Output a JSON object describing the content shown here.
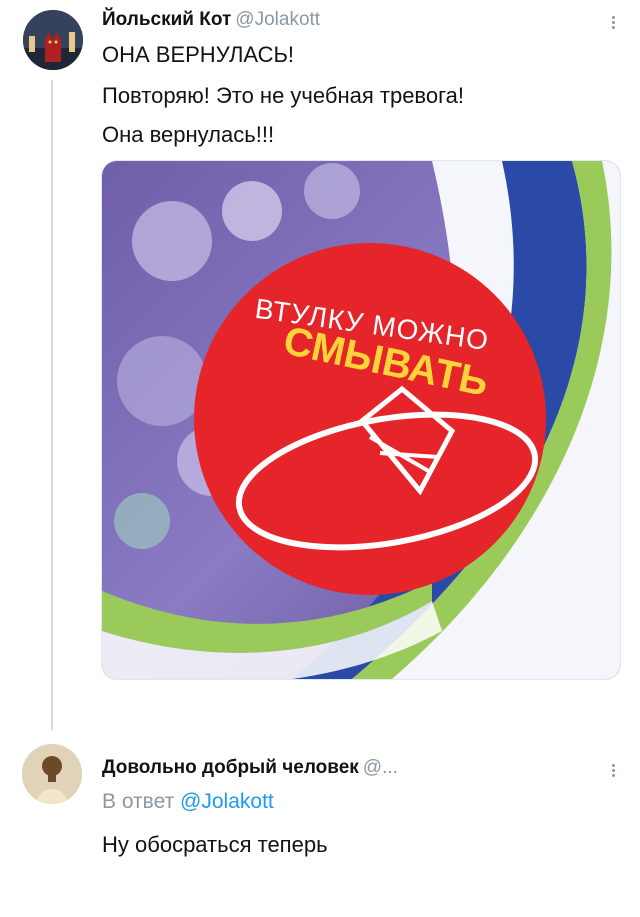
{
  "tweet": {
    "author_name": "Йольский Кот",
    "author_handle": "@Jolakott",
    "lines": [
      "ОНА ВЕРНУЛАСЬ!",
      "Повторяю! Это не учебная тревога!",
      "Она вернулась!!!"
    ],
    "image": {
      "sticker_top_text": "ВТУЛКУ МОЖНО",
      "sticker_main_text": "СМЫВАТЬ",
      "sticker_color": "#e52529",
      "main_text_color": "#ffd43b"
    }
  },
  "reply": {
    "author_name": "Довольно добрый человек",
    "author_handle": "@...",
    "reply_prefix": "В ответ",
    "reply_handle": "@Jolakott",
    "text": "Ну обосраться теперь"
  },
  "icons": {
    "more": "more-vertical-icon"
  },
  "colors": {
    "link": "#1d9bf0",
    "secondary": "#8b98a5",
    "thread_line": "#cfd9de"
  }
}
